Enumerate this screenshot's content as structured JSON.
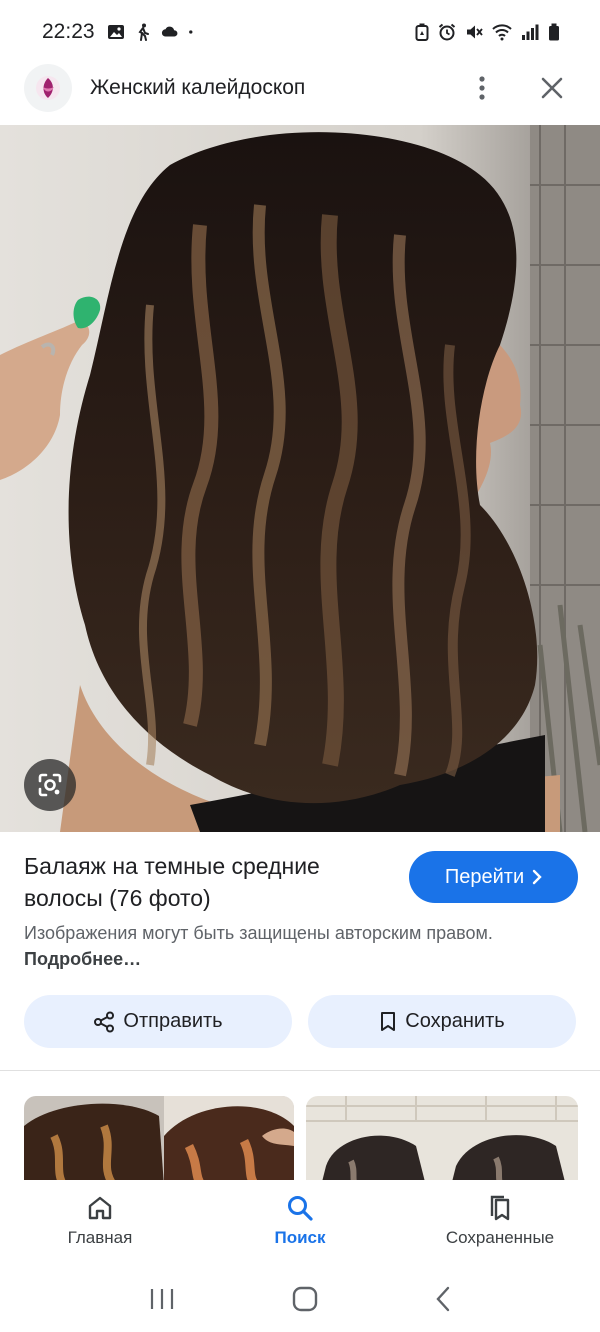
{
  "status_bar": {
    "time": "22:23",
    "left_icons": [
      "gallery-icon",
      "walk-icon",
      "cloud-icon",
      "dot-icon"
    ],
    "right_icons": [
      "battery-saver-icon",
      "alarm-icon",
      "mute-icon",
      "wifi-icon",
      "signal-icon",
      "battery-icon"
    ]
  },
  "top_bar": {
    "title": "Женский калейдоскоп",
    "menu_icon": "more-vert-icon",
    "close_icon": "close-icon",
    "accent": "#a0226e"
  },
  "result": {
    "title": "Балаяж на темные средние волосы (76 фото)",
    "visit_label": "Перейти",
    "copyright_text": "Изображения могут быть защищены авторским правом.",
    "more_link": "Подробнее…",
    "share_label": "Отправить",
    "save_label": "Сохранить"
  },
  "bottom_nav": {
    "items": [
      {
        "label": "Главная",
        "icon": "home-icon"
      },
      {
        "label": "Поиск",
        "icon": "search-icon"
      },
      {
        "label": "Сохраненные",
        "icon": "bookmarks-icon"
      }
    ]
  },
  "colors": {
    "primary": "#1a73e8",
    "pill_bg": "#e8f0fe",
    "text": "#202124",
    "secondary_text": "#5f6368"
  }
}
